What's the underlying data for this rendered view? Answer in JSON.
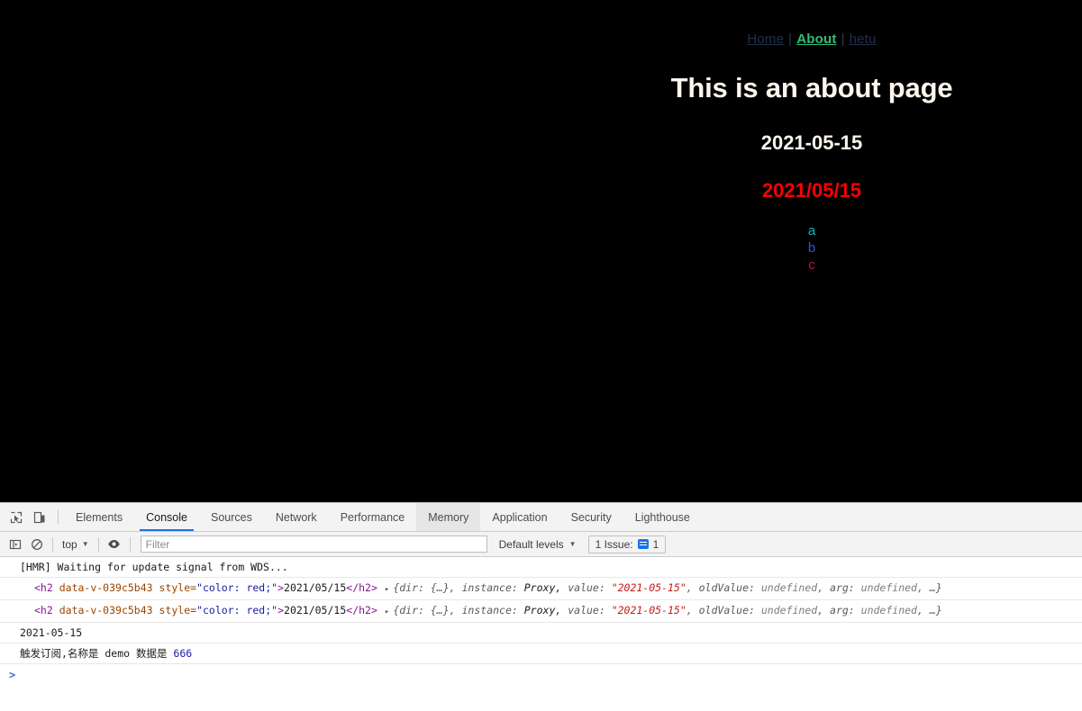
{
  "page": {
    "nav": {
      "links": [
        {
          "label": "Home",
          "active": false
        },
        {
          "label": "About",
          "active": true
        },
        {
          "label": "hetu",
          "active": false
        }
      ],
      "separator": "|"
    },
    "title": "This is an about page",
    "date_plain": "2021-05-15",
    "date_red": "2021/05/15",
    "letters": [
      {
        "text": "a",
        "color": "#16b6b6"
      },
      {
        "text": "b",
        "color": "#2a55d8"
      },
      {
        "text": "c",
        "color": "#c41238"
      }
    ],
    "background_color": "#000000",
    "title_color": "#fdf6ec",
    "active_link_color": "#2cbf79",
    "link_color": "#21304a",
    "red_color": "#fe0000"
  },
  "devtools": {
    "left_icons": [
      {
        "name": "inspect-element-icon"
      },
      {
        "name": "device-toolbar-icon"
      }
    ],
    "tabs": [
      {
        "label": "Elements",
        "state": "normal"
      },
      {
        "label": "Console",
        "state": "active"
      },
      {
        "label": "Sources",
        "state": "normal"
      },
      {
        "label": "Network",
        "state": "normal"
      },
      {
        "label": "Performance",
        "state": "normal"
      },
      {
        "label": "Memory",
        "state": "hovered"
      },
      {
        "label": "Application",
        "state": "normal"
      },
      {
        "label": "Security",
        "state": "normal"
      },
      {
        "label": "Lighthouse",
        "state": "normal"
      }
    ],
    "console_toolbar": {
      "sidebar_toggle_icon": "console-sidebar-icon",
      "clear_icon": "clear-console-icon",
      "context": "top",
      "eye_icon": "live-expressions-eye-icon",
      "filter_placeholder": "Filter",
      "filter_value": "",
      "levels": "Default levels",
      "issues_label": "1 Issue:",
      "issues_count": "1",
      "caret": "▼"
    },
    "log": {
      "rows": [
        {
          "type": "text",
          "text": "[HMR] Waiting for update signal from WDS..."
        },
        {
          "type": "dom",
          "tag_open": "<h2",
          "attr_name": "data-v-039c5b43",
          "attr_style_name": "style=",
          "attr_style_value": "\"color: red;\"",
          "gt": ">",
          "content": "2021/05/15",
          "tag_close": "</h2>",
          "triangle": "▸",
          "object": {
            "open": "{",
            "parts": [
              {
                "key": "dir: ",
                "value": "{…}, "
              },
              {
                "key": "instance: ",
                "value": "Proxy, "
              },
              {
                "key": "value: ",
                "value": "\"2021-05-15\"",
                "is_string": true
              },
              {
                "key": ", oldValue: ",
                "value": "undefined",
                "is_undefined": true
              },
              {
                "key": ", arg: ",
                "value": "undefined",
                "is_undefined": true
              }
            ],
            "tail": ", …}"
          }
        },
        {
          "type": "dom",
          "tag_open": "<h2",
          "attr_name": "data-v-039c5b43",
          "attr_style_name": "style=",
          "attr_style_value": "\"color: red;\"",
          "gt": ">",
          "content": "2021/05/15",
          "tag_close": "</h2>",
          "triangle": "▸",
          "object": {
            "open": "{",
            "parts": [
              {
                "key": "dir: ",
                "value": "{…}, "
              },
              {
                "key": "instance: ",
                "value": "Proxy, "
              },
              {
                "key": "value: ",
                "value": "\"2021-05-15\"",
                "is_string": true
              },
              {
                "key": ", oldValue: ",
                "value": "undefined",
                "is_undefined": true
              },
              {
                "key": ", arg: ",
                "value": "undefined",
                "is_undefined": true
              }
            ],
            "tail": ", …}"
          }
        },
        {
          "type": "text",
          "text": "2021-05-15"
        },
        {
          "type": "mixed",
          "text": "触发订阅,名称是 demo 数据是 ",
          "number": "666"
        }
      ],
      "prompt": ">"
    }
  }
}
